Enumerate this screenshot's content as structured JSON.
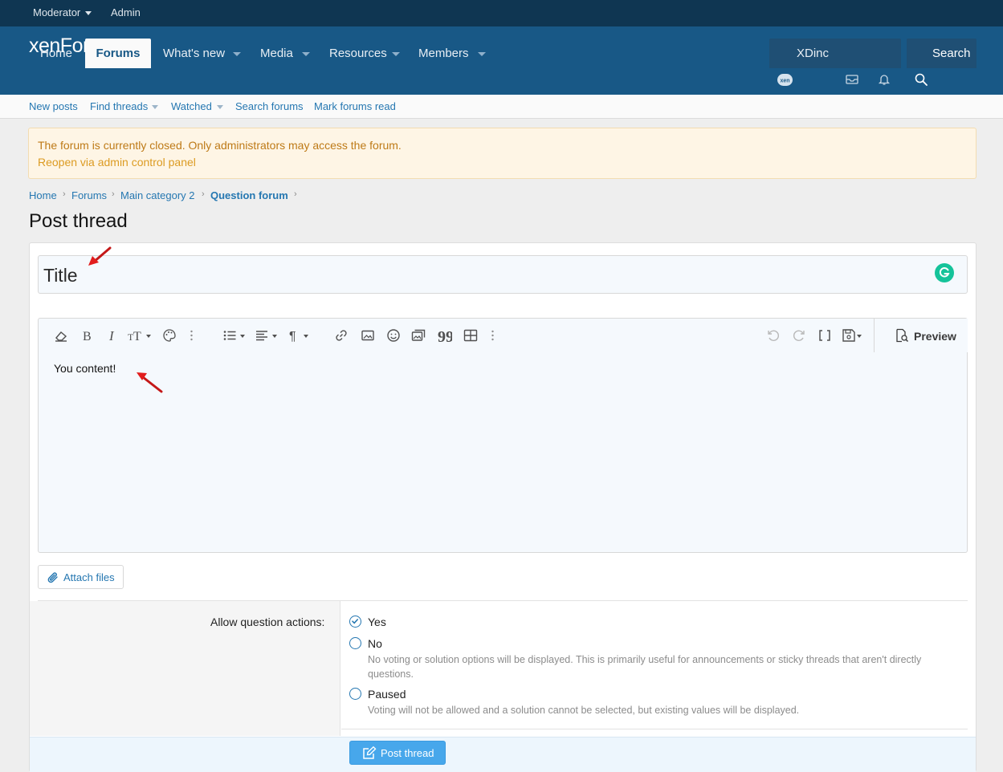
{
  "staff_bar": {
    "moderator": "Moderator",
    "admin": "Admin"
  },
  "header": {
    "logo": "xenForo",
    "tabs": [
      {
        "label": "Home"
      },
      {
        "label": "Forums"
      },
      {
        "label": "What's new"
      },
      {
        "label": "Media"
      },
      {
        "label": "Resources"
      },
      {
        "label": "Members"
      }
    ],
    "user": "XDinc",
    "search": "Search"
  },
  "subnav": {
    "links": [
      "New posts",
      "Find threads",
      "Watched",
      "Search forums",
      "Mark forums read"
    ]
  },
  "notice": {
    "message": "The forum is currently closed. Only administrators may access the forum.",
    "link": "Reopen via admin control panel"
  },
  "breadcrumb": [
    "Home",
    "Forums",
    "Main category 2",
    "Question forum"
  ],
  "page_title": "Post thread",
  "form": {
    "title_placeholder": "Title",
    "editor_content": "You content!",
    "preview_label": "Preview",
    "attach_label": "Attach files",
    "question_actions": {
      "label": "Allow question actions:",
      "options": [
        {
          "label": "Yes",
          "hint": ""
        },
        {
          "label": "No",
          "hint": "No voting or solution options will be displayed. This is primarily useful for announcements or sticky threads that aren't directly questions."
        },
        {
          "label": "Paused",
          "hint": "Voting will not be allowed and a solution cannot be selected, but existing values will be displayed."
        }
      ],
      "selected": "Yes"
    },
    "submit_label": "Post thread"
  },
  "colors": {
    "header": "#185886",
    "staff_bar": "#0f3652",
    "link": "#2577b1",
    "notice_bg": "#fef5e5",
    "notice_text": "#be7a17",
    "submit": "#47a7eb"
  }
}
